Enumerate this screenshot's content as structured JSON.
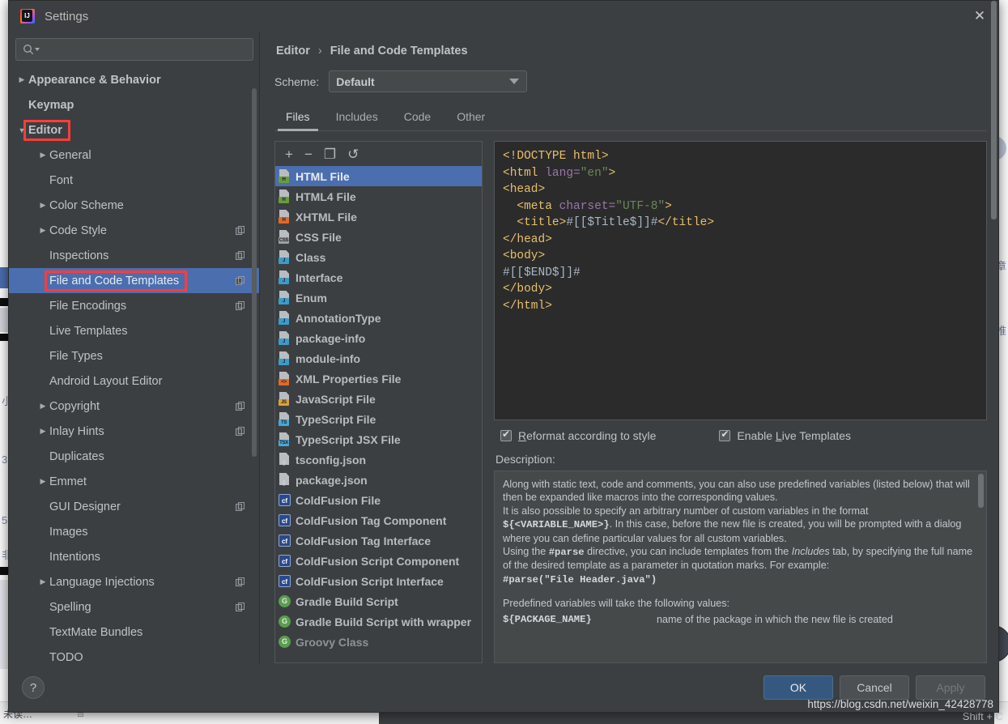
{
  "window": {
    "title": "Settings",
    "app_icon": "intellij-idea-icon",
    "close_icon": "close-icon"
  },
  "sidebar": {
    "search": {
      "placeholder": "",
      "value": "",
      "icon": "search-icon"
    },
    "items": [
      {
        "label": "Appearance & Behavior",
        "arrow": "collapsed",
        "indent": 0,
        "bold": true,
        "badge": false,
        "selected": false
      },
      {
        "label": "Keymap",
        "arrow": "none",
        "indent": 0,
        "bold": true,
        "badge": false,
        "selected": false
      },
      {
        "label": "Editor",
        "arrow": "expanded",
        "indent": 0,
        "bold": true,
        "badge": false,
        "selected": false,
        "highlight": true
      },
      {
        "label": "General",
        "arrow": "collapsed",
        "indent": 1,
        "bold": false,
        "badge": false,
        "selected": false
      },
      {
        "label": "Font",
        "arrow": "none",
        "indent": 1,
        "bold": false,
        "badge": false,
        "selected": false
      },
      {
        "label": "Color Scheme",
        "arrow": "collapsed",
        "indent": 1,
        "bold": false,
        "badge": false,
        "selected": false
      },
      {
        "label": "Code Style",
        "arrow": "collapsed",
        "indent": 1,
        "bold": false,
        "badge": true,
        "selected": false
      },
      {
        "label": "Inspections",
        "arrow": "none",
        "indent": 1,
        "bold": false,
        "badge": true,
        "selected": false
      },
      {
        "label": "File and Code Templates",
        "arrow": "none",
        "indent": 1,
        "bold": false,
        "badge": true,
        "selected": true,
        "highlight": true
      },
      {
        "label": "File Encodings",
        "arrow": "none",
        "indent": 1,
        "bold": false,
        "badge": true,
        "selected": false
      },
      {
        "label": "Live Templates",
        "arrow": "none",
        "indent": 1,
        "bold": false,
        "badge": false,
        "selected": false
      },
      {
        "label": "File Types",
        "arrow": "none",
        "indent": 1,
        "bold": false,
        "badge": false,
        "selected": false
      },
      {
        "label": "Android Layout Editor",
        "arrow": "none",
        "indent": 1,
        "bold": false,
        "badge": false,
        "selected": false
      },
      {
        "label": "Copyright",
        "arrow": "collapsed",
        "indent": 1,
        "bold": false,
        "badge": true,
        "selected": false
      },
      {
        "label": "Inlay Hints",
        "arrow": "collapsed",
        "indent": 1,
        "bold": false,
        "badge": true,
        "selected": false
      },
      {
        "label": "Duplicates",
        "arrow": "none",
        "indent": 1,
        "bold": false,
        "badge": false,
        "selected": false
      },
      {
        "label": "Emmet",
        "arrow": "collapsed",
        "indent": 1,
        "bold": false,
        "badge": false,
        "selected": false
      },
      {
        "label": "GUI Designer",
        "arrow": "none",
        "indent": 1,
        "bold": false,
        "badge": true,
        "selected": false
      },
      {
        "label": "Images",
        "arrow": "none",
        "indent": 1,
        "bold": false,
        "badge": false,
        "selected": false
      },
      {
        "label": "Intentions",
        "arrow": "none",
        "indent": 1,
        "bold": false,
        "badge": false,
        "selected": false
      },
      {
        "label": "Language Injections",
        "arrow": "collapsed",
        "indent": 1,
        "bold": false,
        "badge": true,
        "selected": false
      },
      {
        "label": "Spelling",
        "arrow": "none",
        "indent": 1,
        "bold": false,
        "badge": true,
        "selected": false
      },
      {
        "label": "TextMate Bundles",
        "arrow": "none",
        "indent": 1,
        "bold": false,
        "badge": false,
        "selected": false
      },
      {
        "label": "TODO",
        "arrow": "none",
        "indent": 1,
        "bold": false,
        "badge": false,
        "selected": false
      }
    ]
  },
  "content": {
    "breadcrumb": {
      "parent": "Editor",
      "separator": "›",
      "current": "File and Code Templates"
    },
    "scheme": {
      "label": "Scheme:",
      "value": "Default",
      "arrow_icon": "chevron-down-icon"
    },
    "tabs": [
      {
        "label": "Files",
        "active": true
      },
      {
        "label": "Includes",
        "active": false
      },
      {
        "label": "Code",
        "active": false
      },
      {
        "label": "Other",
        "active": false
      }
    ],
    "toolbar": [
      {
        "icon": "plus-icon",
        "glyph": "+"
      },
      {
        "icon": "minus-icon",
        "glyph": "−"
      },
      {
        "icon": "copy-icon",
        "glyph": "❐"
      },
      {
        "icon": "reset-icon",
        "glyph": "↺"
      }
    ],
    "templates": [
      {
        "label": "HTML File",
        "icon": "html-file-icon",
        "badge_text": "H",
        "badge_color": "#6a9c3b",
        "style": "file",
        "selected": true
      },
      {
        "label": "HTML4 File",
        "icon": "html4-file-icon",
        "badge_text": "H",
        "badge_color": "#6a9c3b",
        "style": "file",
        "selected": false
      },
      {
        "label": "XHTML File",
        "icon": "xhtml-file-icon",
        "badge_text": "H",
        "badge_color": "#e06a2b",
        "style": "file",
        "selected": false
      },
      {
        "label": "CSS File",
        "icon": "css-file-icon",
        "badge_text": "CSS",
        "badge_color": "#9aa0a6",
        "style": "file",
        "selected": false
      },
      {
        "label": "Class",
        "icon": "java-class-icon",
        "badge_text": "J",
        "badge_color": "#3d9bc9",
        "style": "file",
        "selected": false
      },
      {
        "label": "Interface",
        "icon": "java-interface-icon",
        "badge_text": "J",
        "badge_color": "#3d9bc9",
        "style": "file",
        "selected": false
      },
      {
        "label": "Enum",
        "icon": "java-enum-icon",
        "badge_text": "J",
        "badge_color": "#3d9bc9",
        "style": "file",
        "selected": false
      },
      {
        "label": "AnnotationType",
        "icon": "java-annotation-icon",
        "badge_text": "J",
        "badge_color": "#3d9bc9",
        "style": "file",
        "selected": false
      },
      {
        "label": "package-info",
        "icon": "package-info-icon",
        "badge_text": "J",
        "badge_color": "#3d9bc9",
        "style": "file",
        "selected": false
      },
      {
        "label": "module-info",
        "icon": "module-info-icon",
        "badge_text": "J",
        "badge_color": "#3d9bc9",
        "style": "file",
        "selected": false
      },
      {
        "label": "XML Properties File",
        "icon": "xml-file-icon",
        "badge_text": "<>",
        "badge_color": "#e06a2b",
        "style": "file",
        "selected": false
      },
      {
        "label": "JavaScript File",
        "icon": "javascript-file-icon",
        "badge_text": "JS",
        "badge_color": "#d8a23a",
        "style": "file",
        "selected": false
      },
      {
        "label": "TypeScript File",
        "icon": "typescript-file-icon",
        "badge_text": "TS",
        "badge_color": "#4aa6d8",
        "style": "file",
        "selected": false
      },
      {
        "label": "TypeScript JSX File",
        "icon": "tsx-file-icon",
        "badge_text": "TSX",
        "badge_color": "#4aa6d8",
        "style": "file",
        "selected": false
      },
      {
        "label": "tsconfig.json",
        "icon": "json-file-icon",
        "badge_text": "{}",
        "badge_color": "#8f9499",
        "style": "json",
        "selected": false
      },
      {
        "label": "package.json",
        "icon": "json-file-icon",
        "badge_text": "{}",
        "badge_color": "#8f9499",
        "style": "json",
        "selected": false
      },
      {
        "label": "ColdFusion File",
        "icon": "coldfusion-icon",
        "badge_text": "cf",
        "badge_color": "#2b4a8c",
        "style": "square",
        "selected": false
      },
      {
        "label": "ColdFusion Tag Component",
        "icon": "coldfusion-icon",
        "badge_text": "cf",
        "badge_color": "#2b4a8c",
        "style": "square",
        "selected": false
      },
      {
        "label": "ColdFusion Tag Interface",
        "icon": "coldfusion-icon",
        "badge_text": "cf",
        "badge_color": "#2b4a8c",
        "style": "square",
        "selected": false
      },
      {
        "label": "ColdFusion Script Component",
        "icon": "coldfusion-icon",
        "badge_text": "cf",
        "badge_color": "#2b4a8c",
        "style": "square",
        "selected": false
      },
      {
        "label": "ColdFusion Script Interface",
        "icon": "coldfusion-icon",
        "badge_text": "cf",
        "badge_color": "#2b4a8c",
        "style": "square",
        "selected": false
      },
      {
        "label": "Gradle Build Script",
        "icon": "gradle-icon",
        "badge_text": "G",
        "badge_color": "#5a9e4f",
        "style": "round",
        "selected": false
      },
      {
        "label": "Gradle Build Script with wrapper",
        "icon": "gradle-icon",
        "badge_text": "G",
        "badge_color": "#5a9e4f",
        "style": "round",
        "selected": false
      },
      {
        "label": "Groovy Class",
        "icon": "groovy-icon",
        "badge_text": "G",
        "badge_color": "#5a9e4f",
        "style": "round",
        "selected": false,
        "dim": true
      }
    ],
    "code": [
      [
        {
          "t": "<!DOCTYPE html>",
          "c": "tg"
        }
      ],
      [
        {
          "t": "<html ",
          "c": "tg"
        },
        {
          "t": "lang=",
          "c": "at"
        },
        {
          "t": "\"en\"",
          "c": "st"
        },
        {
          "t": ">",
          "c": "tg"
        }
      ],
      [
        {
          "t": "<head>",
          "c": "tg"
        }
      ],
      [
        {
          "t": "  <meta ",
          "c": "tg"
        },
        {
          "t": "charset=",
          "c": "at"
        },
        {
          "t": "\"UTF-8\"",
          "c": "st"
        },
        {
          "t": ">",
          "c": "tg"
        }
      ],
      [
        {
          "t": "  <title>",
          "c": "tg"
        },
        {
          "t": "#[[$Title$]]#",
          "c": "pl"
        },
        {
          "t": "</title>",
          "c": "tg"
        }
      ],
      [
        {
          "t": "</head>",
          "c": "tg"
        }
      ],
      [
        {
          "t": "<body>",
          "c": "tg"
        }
      ],
      [
        {
          "t": "#[[$END$]]#",
          "c": "pl"
        }
      ],
      [
        {
          "t": "</body>",
          "c": "tg"
        }
      ],
      [
        {
          "t": "</html>",
          "c": "tg"
        }
      ]
    ],
    "checkboxes": [
      {
        "label_pre": "",
        "label_key": "R",
        "label_post": "eformat according to style",
        "checked": true,
        "name": "reformat-according-to-style-checkbox"
      },
      {
        "label_pre": "Enable ",
        "label_key": "L",
        "label_post": "ive Templates",
        "checked": true,
        "name": "enable-live-templates-checkbox"
      }
    ],
    "description_title": "Description:",
    "description": {
      "paragraphs": [
        "Along with static text, code and comments, you can also use predefined variables (listed below) that will then be expanded like macros into the corresponding values.",
        "It is also possible to specify an arbitrary number of custom variables in the format",
        "${<VARIABLE_NAME>}",
        ". In this case, before the new file is created, you will be prompted with a dialog where you can define particular values for all custom variables.",
        "Using the ",
        "#parse",
        " directive, you can include templates from the ",
        "Includes",
        " tab, by specifying the full name of the desired template as a parameter in quotation marks. For example:",
        "#parse(\"File Header.java\")",
        "Predefined variables will take the following values:"
      ],
      "variables": [
        {
          "name": "${PACKAGE_NAME}",
          "description": "name of the package in which the new file is created"
        }
      ]
    }
  },
  "footer": {
    "help_label": "?",
    "help_icon": "question-mark-icon",
    "buttons": [
      {
        "label": "OK",
        "kind": "primary",
        "name": "ok-button"
      },
      {
        "label": "Cancel",
        "kind": "normal",
        "name": "cancel-button"
      },
      {
        "label": "Apply",
        "kind": "disabled",
        "name": "apply-button"
      }
    ]
  },
  "watermark": "https://blog.csdn.net/weixin_42428778",
  "background": {
    "status_left": "未读…",
    "shift_hint": "Shift + C",
    "glyphs": [
      "小",
      "3",
      "5",
      "非"
    ],
    "cjk": [
      "章",
      "椎"
    ]
  },
  "colors": {
    "dialog_bg": "#3c3f41",
    "selection_blue": "#4b6eaf",
    "highlight_red": "#fc3d3d",
    "primary_button": "#365880",
    "editor_bg": "#2b2b2b"
  }
}
